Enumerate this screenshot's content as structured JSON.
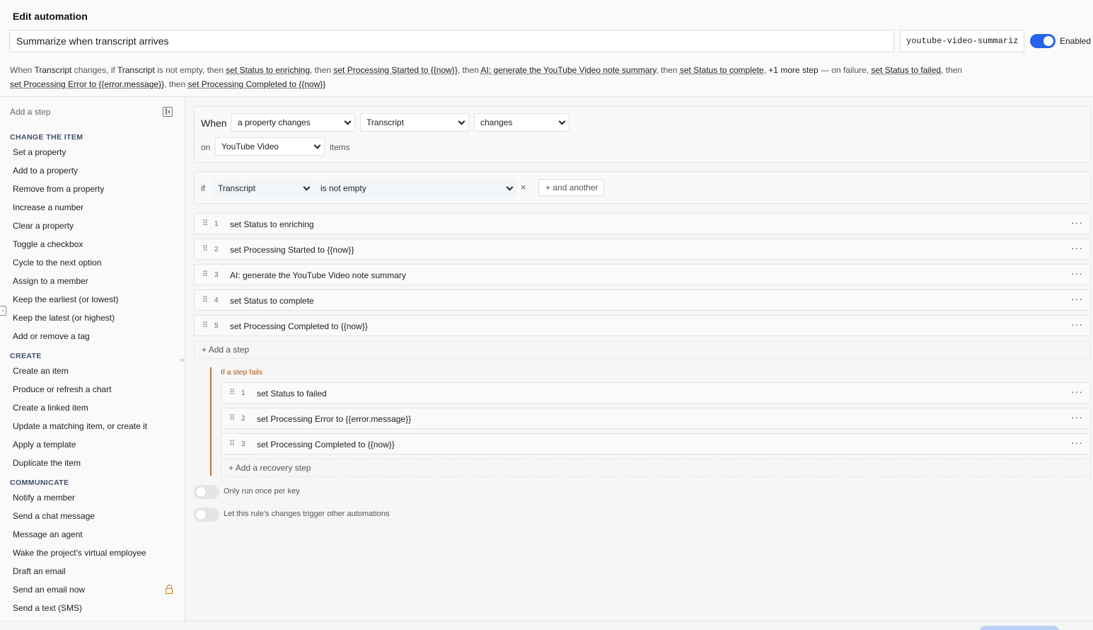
{
  "header": {
    "title": "Edit automation",
    "name": "Summarize when transcript arrives",
    "key": "youtube-video-summariz",
    "enabled_label": "Enabled"
  },
  "summary": {
    "p1": "When ",
    "trigger_prop": "Transcript",
    "p2": " changes, if ",
    "cond_prop": "Transcript",
    "p3": " is not empty, then ",
    "s1": "set Status to enriching",
    "p4": ", then ",
    "s2": "set Processing Started to {{now}}",
    "p5": ", then ",
    "s3": "AI: generate the YouTube Video note summary",
    "p6": ", then ",
    "s4": "set Status to complete",
    "p7": ", ",
    "more": "+1 more step",
    "p8": " — on failure, ",
    "f1": "set Status to failed",
    "p9": ", then",
    "f2": "set Processing Error to {{error.message}}",
    "p10": ", then ",
    "f3": "set Processing Completed to {{now}}"
  },
  "sidebar": {
    "add_step": "Add a step",
    "sections": [
      {
        "heading": "CHANGE THE ITEM",
        "items": [
          "Set a property",
          "Add to a property",
          "Remove from a property",
          "Increase a number",
          "Clear a property",
          "Toggle a checkbox",
          "Cycle to the next option",
          "Assign to a member",
          "Keep the earliest (or lowest)",
          "Keep the latest (or highest)",
          "Add or remove a tag"
        ]
      },
      {
        "heading": "CREATE",
        "items": [
          "Create an item",
          "Produce or refresh a chart",
          "Create a linked item",
          "Update a matching item, or create it",
          "Apply a template",
          "Duplicate the item"
        ]
      },
      {
        "heading": "COMMUNICATE",
        "items": [
          "Notify a member",
          "Send a chat message",
          "Message an agent",
          "Wake the project's virtual employee",
          "Draft an email",
          "Send an email now",
          "Send a text (SMS)"
        ]
      }
    ]
  },
  "trigger": {
    "when_label": "When",
    "event": "a property changes",
    "property": "Transcript",
    "change": "changes",
    "on_label": "on",
    "collection": "YouTube Video",
    "items_label": "items"
  },
  "condition": {
    "if_label": "if",
    "property": "Transcript",
    "operator": "is not empty",
    "remove": "×",
    "and_another": "and another"
  },
  "steps": [
    {
      "num": "1",
      "text": "set Status to enriching"
    },
    {
      "num": "2",
      "text": "set Processing Started to {{now}}"
    },
    {
      "num": "3",
      "text": "AI: generate the YouTube Video note summary"
    },
    {
      "num": "4",
      "text": "set Status to complete"
    },
    {
      "num": "5",
      "text": "set Processing Completed to {{now}}"
    }
  ],
  "add_step": "Add a step",
  "failure": {
    "label": "If a step fails",
    "steps": [
      {
        "num": "1",
        "text": "set Status to failed"
      },
      {
        "num": "2",
        "text": "set Processing Error to {{error.message}}"
      },
      {
        "num": "3",
        "text": "set Processing Completed to {{now}}"
      }
    ],
    "add_recovery": "Add a recovery step"
  },
  "options": {
    "run_once": "Only run once per key",
    "trigger_others": "Let this rule's changes trigger other automations"
  },
  "colors": {
    "accent": "#2563eb",
    "failure": "#c2773f"
  }
}
